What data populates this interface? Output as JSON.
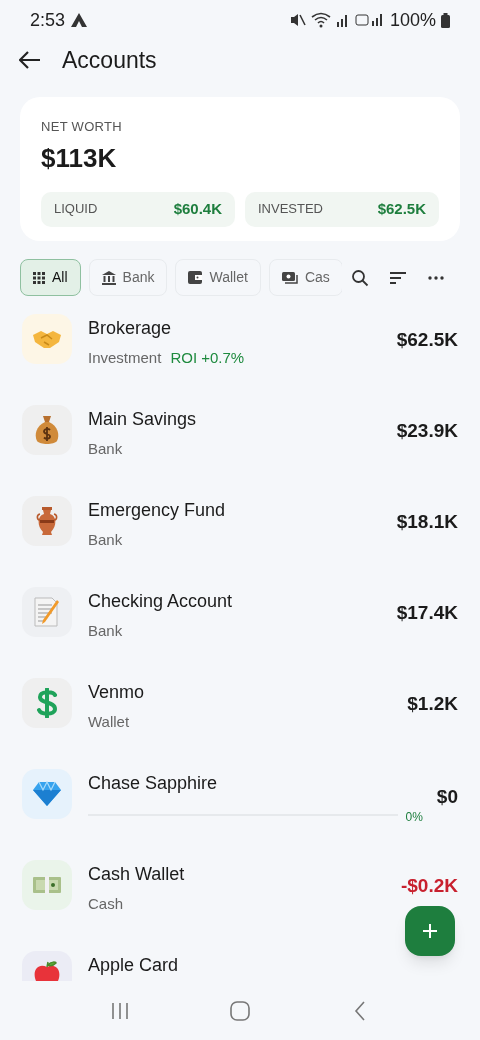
{
  "status_bar": {
    "time": "2:53",
    "battery": "100%"
  },
  "header": {
    "title": "Accounts"
  },
  "net_worth": {
    "label": "NET WORTH",
    "value": "$113K",
    "parts": [
      {
        "label": "LIQUID",
        "value": "$60.4K"
      },
      {
        "label": "INVESTED",
        "value": "$62.5K"
      }
    ]
  },
  "filters": [
    {
      "label": "All",
      "selected": true
    },
    {
      "label": "Bank",
      "selected": false
    },
    {
      "label": "Wallet",
      "selected": false
    },
    {
      "label": "Cas",
      "selected": false
    }
  ],
  "accounts": [
    {
      "kind": "subtitle",
      "name": "Brokerage",
      "type": "Investment",
      "roi": "ROI +0.7%",
      "value": "$62.5K",
      "negative": false
    },
    {
      "kind": "subtitle",
      "name": "Main Savings",
      "type": "Bank",
      "value": "$23.9K",
      "negative": false
    },
    {
      "kind": "subtitle",
      "name": "Emergency Fund",
      "type": "Bank",
      "value": "$18.1K",
      "negative": false
    },
    {
      "kind": "subtitle",
      "name": "Checking Account",
      "type": "Bank",
      "value": "$17.4K",
      "negative": false
    },
    {
      "kind": "subtitle",
      "name": "Venmo",
      "type": "Wallet",
      "value": "$1.2K",
      "negative": false
    },
    {
      "kind": "progress",
      "name": "Chase Sapphire",
      "level": 0,
      "percent": "0%",
      "value": "$0",
      "negative": false
    },
    {
      "kind": "subtitle",
      "name": "Cash Wallet",
      "type": "Cash",
      "value": "-$0.2K",
      "negative": true
    },
    {
      "kind": "subtitle",
      "name": "Apple Card"
    }
  ]
}
